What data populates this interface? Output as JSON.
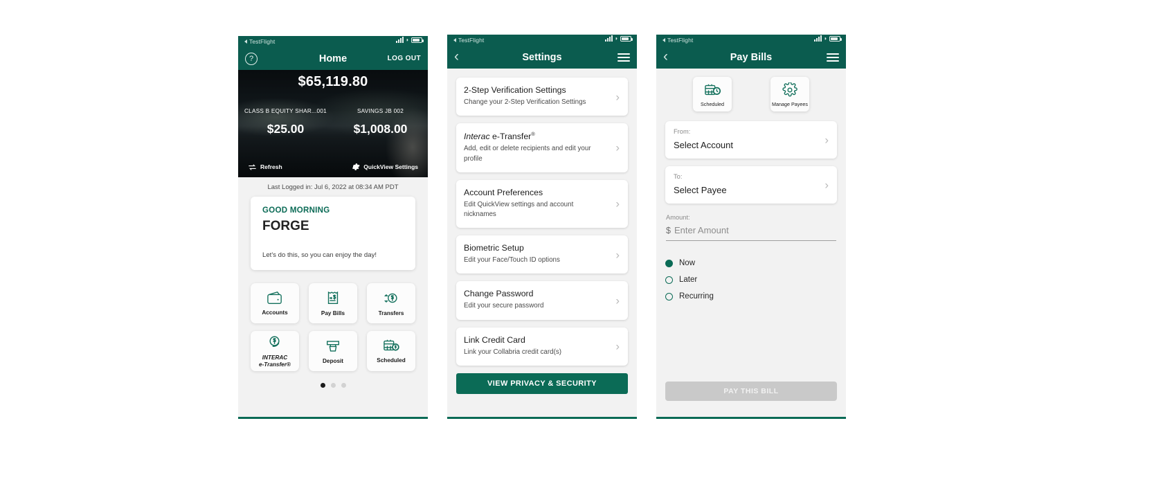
{
  "statusbar": {
    "app_label": "TestFlight"
  },
  "home": {
    "nav": {
      "help_icon": "question-circle-icon",
      "title": "Home",
      "logout_label": "LOG OUT"
    },
    "hero": {
      "total_balance": "$65,119.80",
      "accounts": [
        {
          "label": "CLASS B EQUITY SHAR...001",
          "amount": "$25.00"
        },
        {
          "label": "SAVINGS JB 002",
          "amount": "$1,008.00"
        }
      ],
      "refresh_label": "Refresh",
      "refresh_icon": "refresh-arrows-icon",
      "quickview_label": "QuickView Settings",
      "quickview_icon": "gear-icon"
    },
    "last_logged_in": "Last Logged in: Jul 6, 2022 at 08:34 AM  PDT",
    "greeting": {
      "eyebrow": "GOOD MORNING",
      "name": "FORGE",
      "message": "Let's do this, so you can enjoy the day!"
    },
    "tiles": [
      {
        "label": "Accounts",
        "icon": "wallet-icon"
      },
      {
        "label": "Pay Bills",
        "icon": "bill-dollar-icon"
      },
      {
        "label": "Transfers",
        "icon": "transfer-arrows-dollar-icon"
      },
      {
        "label_line1": "INTERAC",
        "label_line2": "e-Transfer®",
        "icon": "interac-dollar-arrow-icon"
      },
      {
        "label": "Deposit",
        "icon": "deposit-cheque-icon"
      },
      {
        "label": "Scheduled",
        "icon": "calendar-dollar-icon"
      }
    ],
    "pager": {
      "total": 3,
      "active": 1
    }
  },
  "settings": {
    "nav": {
      "back_icon": "chevron-left-icon",
      "title": "Settings",
      "menu_icon": "hamburger-menu-icon"
    },
    "items": [
      {
        "title": "2-Step Verification Settings",
        "subtitle": "Change your 2-Step Verification Settings"
      },
      {
        "title_italic": "Interac",
        "title_rest": " e-Transfer",
        "title_sup": "®",
        "subtitle": "Add, edit or delete recipients and edit your profile"
      },
      {
        "title": "Account Preferences",
        "subtitle": "Edit QuickView settings and account nicknames"
      },
      {
        "title": "Biometric Setup",
        "subtitle": "Edit your Face/Touch ID options"
      },
      {
        "title": "Change Password",
        "subtitle": "Edit your secure password"
      },
      {
        "title": "Link Credit Card",
        "subtitle": "Link your Collabria credit card(s)"
      }
    ],
    "privacy_button": "VIEW PRIVACY & SECURITY"
  },
  "paybills": {
    "nav": {
      "back_icon": "chevron-left-icon",
      "title": "Pay Bills",
      "menu_icon": "hamburger-menu-icon"
    },
    "tabs": [
      {
        "label": "Scheduled",
        "icon": "calendar-clock-icon"
      },
      {
        "label": "Manage Payees",
        "icon": "gear-icon"
      }
    ],
    "fields": [
      {
        "label": "From:",
        "value": "Select Account"
      },
      {
        "label": "To:",
        "value": "Select Payee"
      }
    ],
    "amount": {
      "label": "Amount:",
      "currency": "$",
      "placeholder": "Enter Amount",
      "value": ""
    },
    "schedule_options": [
      {
        "label": "Now",
        "selected": true
      },
      {
        "label": "Later",
        "selected": false
      },
      {
        "label": "Recurring",
        "selected": false
      }
    ],
    "submit_button": "PAY THIS BILL"
  },
  "colors": {
    "brand_green": "#0b6b56",
    "nav_green": "#0b5c4f",
    "disabled_gray": "#c9c9c9"
  }
}
